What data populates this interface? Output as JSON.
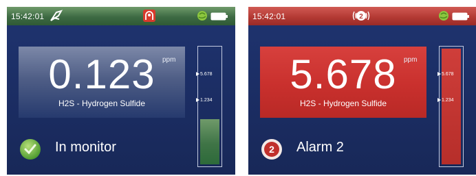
{
  "screens": [
    {
      "time": "15:42:01",
      "icons": [
        "satellite-icon",
        "alarm-indicator-icon",
        "gps-globe-icon",
        "battery-icon"
      ],
      "value": "0.123",
      "unit": "ppm",
      "gas": "H2S - Hydrogen Sulfide",
      "thresholds": [
        "5.678",
        "1.234"
      ],
      "level": 0.38,
      "state": "In monitor",
      "state_icon": "check-icon",
      "statusbar_color": "#3d6a43"
    },
    {
      "time": "15:42:01",
      "icons": [
        "alarm-2-bell-icon",
        "gps-globe-icon",
        "battery-icon"
      ],
      "value": "5.678",
      "unit": "ppm",
      "gas": "H2S - Hydrogen Sulfide",
      "thresholds": [
        "5.678",
        "1.234"
      ],
      "level": 1.0,
      "state": "Alarm 2",
      "state_icon": "alarm-2-icon",
      "alarm_level": "2",
      "statusbar_color": "#b43a34"
    }
  ]
}
